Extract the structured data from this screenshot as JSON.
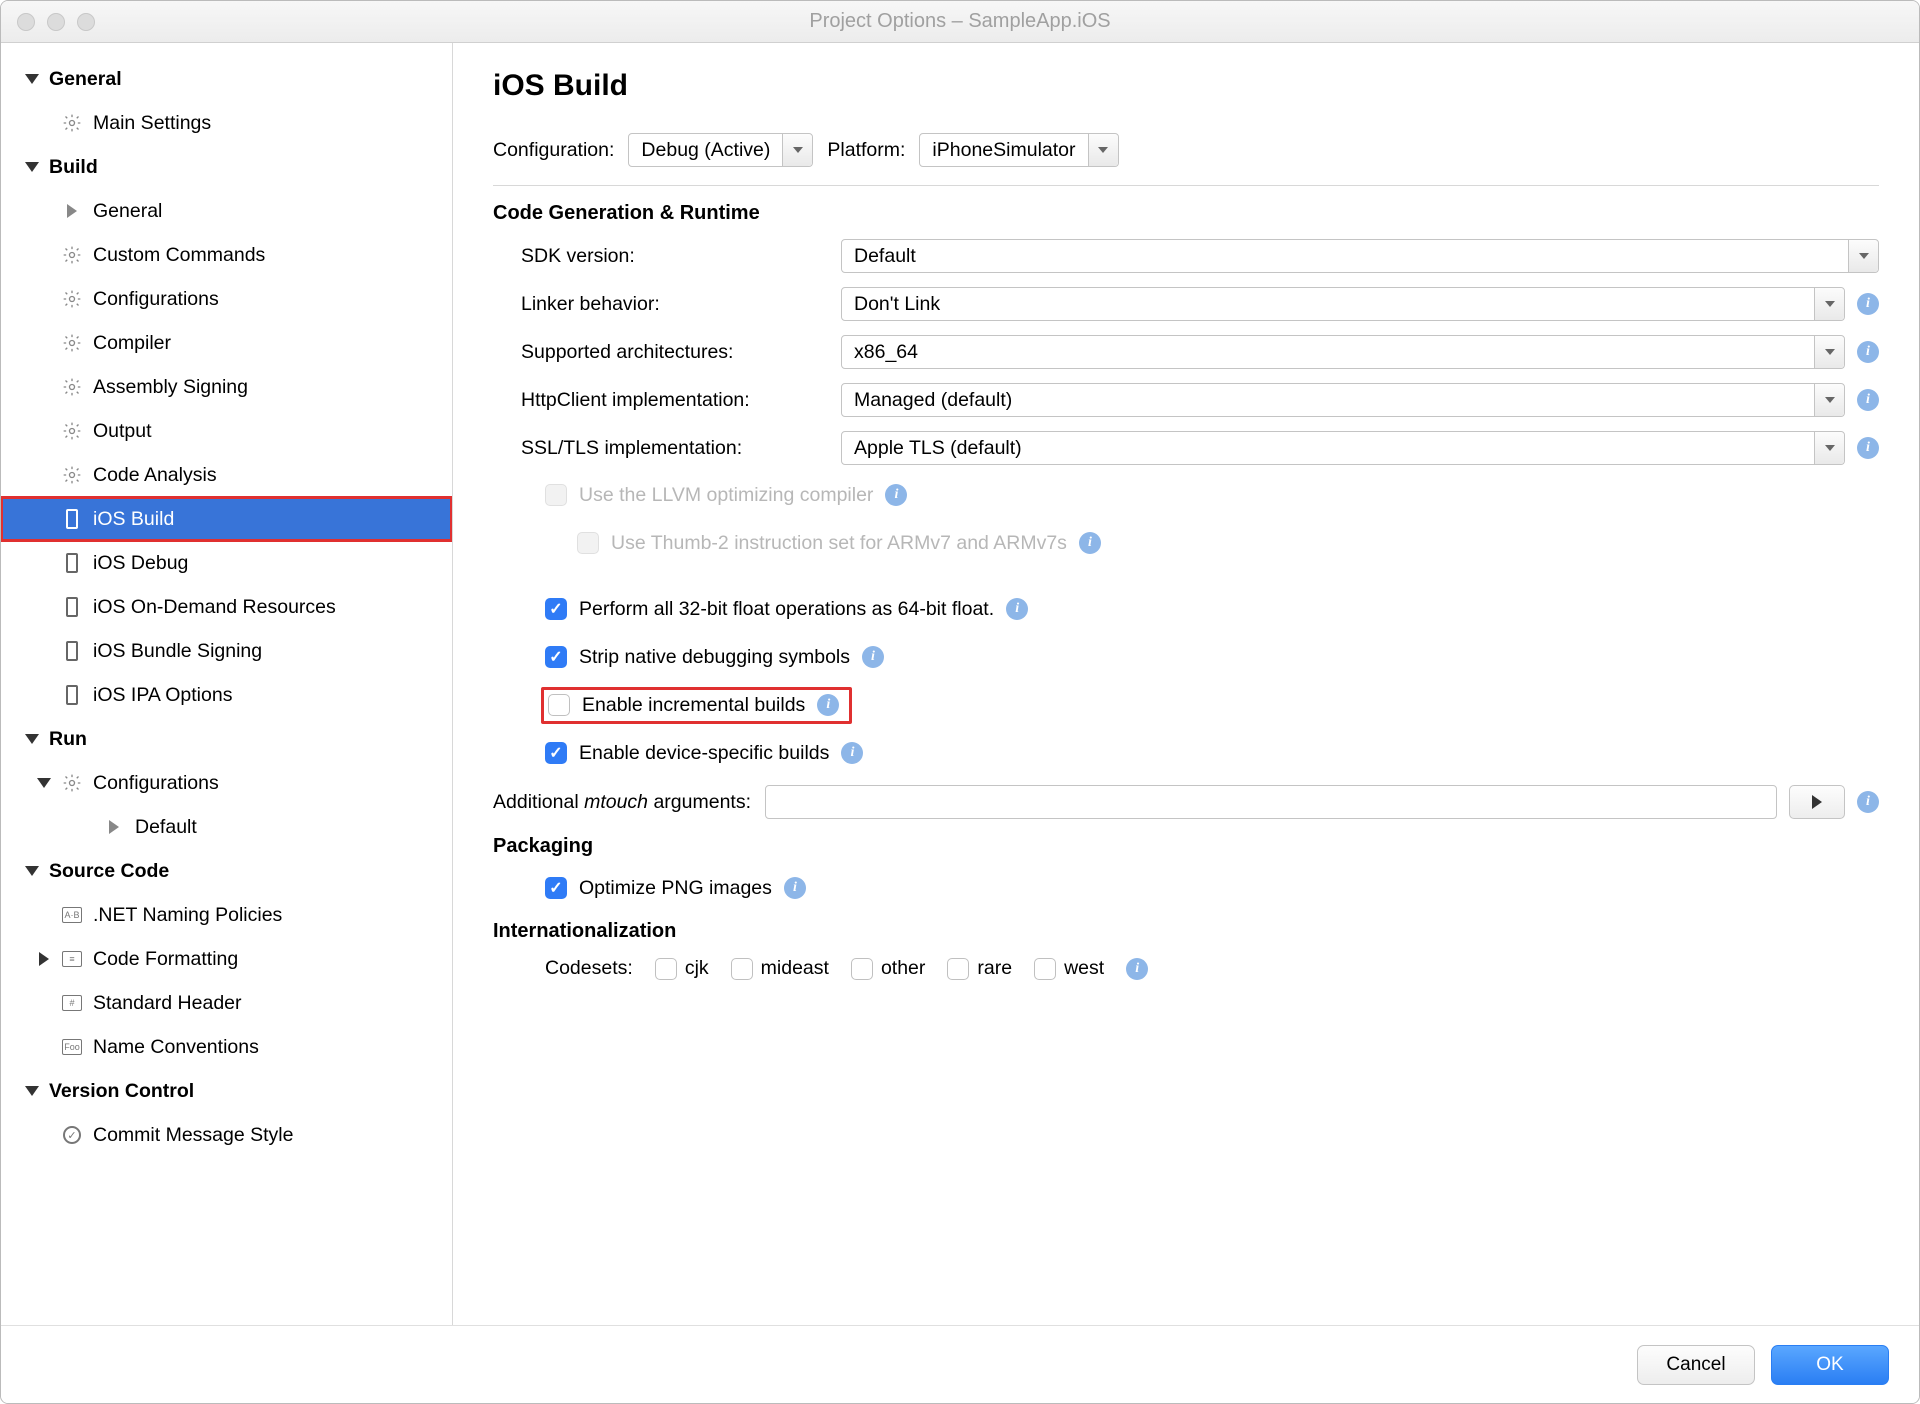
{
  "window": {
    "title": "Project Options – SampleApp.iOS"
  },
  "sidebar": {
    "general": {
      "label": "General",
      "items": {
        "main_settings": "Main Settings"
      }
    },
    "build": {
      "label": "Build",
      "items": {
        "general": "General",
        "custom_commands": "Custom Commands",
        "configurations": "Configurations",
        "compiler": "Compiler",
        "assembly_signing": "Assembly Signing",
        "output": "Output",
        "code_analysis": "Code Analysis",
        "ios_build": "iOS Build",
        "ios_debug": "iOS Debug",
        "ios_on_demand": "iOS On-Demand Resources",
        "ios_bundle_signing": "iOS Bundle Signing",
        "ios_ipa_options": "iOS IPA Options"
      }
    },
    "run": {
      "label": "Run",
      "configurations": "Configurations",
      "default": "Default"
    },
    "source_code": {
      "label": "Source Code",
      "items": {
        "naming": ".NET Naming Policies",
        "formatting": "Code Formatting",
        "standard_header": "Standard Header",
        "name_conventions": "Name Conventions"
      }
    },
    "version_control": {
      "label": "Version Control",
      "commit_style": "Commit Message Style"
    }
  },
  "page": {
    "title": "iOS Build",
    "configuration_label": "Configuration:",
    "configuration_value": "Debug (Active)",
    "platform_label": "Platform:",
    "platform_value": "iPhoneSimulator",
    "section_codegen": "Code Generation & Runtime",
    "sdk_version_label": "SDK version:",
    "sdk_version_value": "Default",
    "linker_label": "Linker behavior:",
    "linker_value": "Don't Link",
    "arch_label": "Supported architectures:",
    "arch_value": "x86_64",
    "httpclient_label": "HttpClient implementation:",
    "httpclient_value": "Managed (default)",
    "ssl_label": "SSL/TLS implementation:",
    "ssl_value": "Apple TLS (default)",
    "llvm_label": "Use the LLVM optimizing compiler",
    "thumb2_label": "Use Thumb-2 instruction set for ARMv7 and ARMv7s",
    "float32_label": "Perform all 32-bit float operations as 64-bit float.",
    "strip_label": "Strip native debugging symbols",
    "incremental_label": "Enable incremental builds",
    "device_specific_label": "Enable device-specific builds",
    "mtouch_label_pre": "Additional ",
    "mtouch_label_em": "mtouch",
    "mtouch_label_post": " arguments:",
    "section_packaging": "Packaging",
    "optimize_png_label": "Optimize PNG images",
    "section_i18n": "Internationalization",
    "codesets_label": "Codesets:",
    "codesets": {
      "cjk": "cjk",
      "mideast": "mideast",
      "other": "other",
      "rare": "rare",
      "west": "west"
    }
  },
  "buttons": {
    "cancel": "Cancel",
    "ok": "OK"
  }
}
